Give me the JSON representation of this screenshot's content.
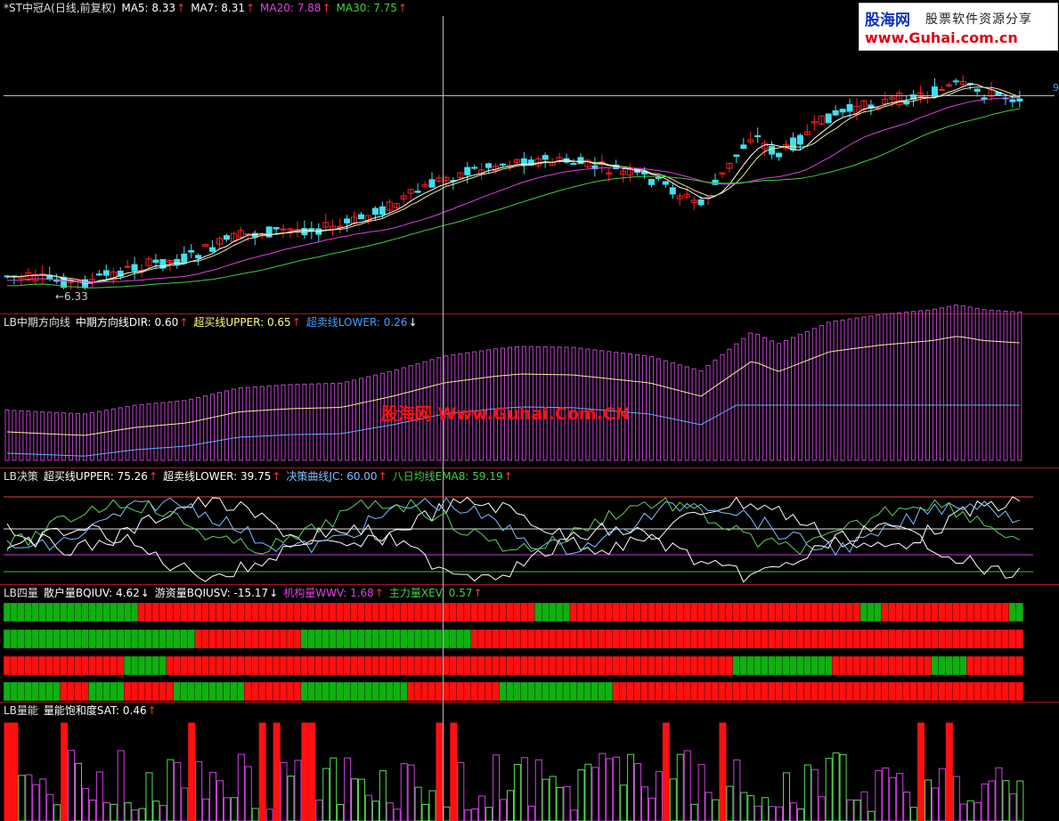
{
  "panels": {
    "main": {
      "items": [
        {
          "text": "*ST中冠A(日线,前复权)",
          "color": "#e0e0e0"
        },
        {
          "text": "MA5: 8.33",
          "color": "#ffffff",
          "dir": "up"
        },
        {
          "text": "MA7: 8.31",
          "color": "#ffffff",
          "dir": "up"
        },
        {
          "text": "MA20: 7.88",
          "color": "#e040e0",
          "dir": "up"
        },
        {
          "text": "MA30: 7.75",
          "color": "#40d040",
          "dir": "up"
        }
      ],
      "low_label": "←6.33",
      "right_mark": "9"
    },
    "dir": {
      "items": [
        {
          "text": "LB中期方向线",
          "color": "#e0e0e0"
        },
        {
          "text": "中期方向线DIR: 0.60",
          "color": "#ffffff",
          "dir": "up"
        },
        {
          "text": "超买线UPPER: 0.65",
          "color": "#ffff80",
          "dir": "up"
        },
        {
          "text": "超卖线LOWER: 0.26",
          "color": "#40a0ff",
          "dir": "down"
        }
      ]
    },
    "decision": {
      "items": [
        {
          "text": "LB决策",
          "color": "#e0e0e0"
        },
        {
          "text": "超买线UPPER: 75.26",
          "color": "#ffffff",
          "dir": "up"
        },
        {
          "text": "超卖线LOWER: 39.75",
          "color": "#ffffff",
          "dir": "up"
        },
        {
          "text": "决策曲线JC: 60.00",
          "color": "#80c0ff",
          "dir": "up"
        },
        {
          "text": "八日均线EMA8: 59.19",
          "color": "#40d040",
          "dir": "up"
        }
      ]
    },
    "four": {
      "items": [
        {
          "text": "LB四量",
          "color": "#e0e0e0"
        },
        {
          "text": "散户量BQIUV: 4.62",
          "color": "#ffffff",
          "dir": "down"
        },
        {
          "text": "游资量BQIUSV: -15.17",
          "color": "#ffffff",
          "dir": "down"
        },
        {
          "text": "机构量WWV: 1.68",
          "color": "#e040e0",
          "dir": "up"
        },
        {
          "text": "主力量XEV: 0.57",
          "color": "#40d040",
          "dir": "up"
        }
      ]
    },
    "energy": {
      "items": [
        {
          "text": "LB量能",
          "color": "#e0e0e0"
        },
        {
          "text": "量能饱和度SAT: 0.46",
          "color": "#ffffff",
          "dir": "up"
        }
      ]
    }
  },
  "logo": {
    "cn": "股海网",
    "slogan": "股票软件资源分享",
    "url": "www.Guhai.com.cn"
  },
  "watermark": "股海网 Www.Guhai.Com.CN",
  "colors": {
    "up": "#ff2020",
    "down": "#40e0f0",
    "ma5": "#ffffff",
    "ma20": "#e040e0",
    "ma30": "#40d040"
  }
}
